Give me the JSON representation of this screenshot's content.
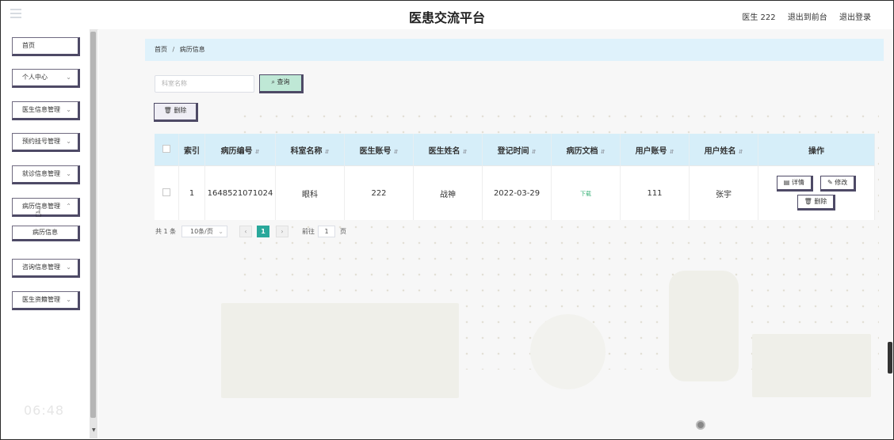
{
  "header": {
    "title": "医患交流平台",
    "user": "医生 222",
    "back_to_front": "退出到前台",
    "logout": "退出登录"
  },
  "sidebar": {
    "items": [
      {
        "label": "首页"
      },
      {
        "label": "个人中心"
      },
      {
        "label": "医生信息管理"
      },
      {
        "label": "预约挂号管理"
      },
      {
        "label": "就诊信息管理"
      },
      {
        "label": "病历信息管理"
      },
      {
        "label": "病历信息"
      },
      {
        "label": "咨询信息管理"
      },
      {
        "label": "医生资籍管理"
      }
    ],
    "timestamp": "06:48"
  },
  "breadcrumb": {
    "home": "首页",
    "sep": "/",
    "current": "病历信息"
  },
  "search": {
    "placeholder": "科室名称",
    "button": "查询"
  },
  "toolbar": {
    "delete": "删除"
  },
  "table": {
    "headers": [
      "索引",
      "病历编号",
      "科室名称",
      "医生账号",
      "医生姓名",
      "登记时间",
      "病历文档",
      "用户账号",
      "用户姓名",
      "操作"
    ],
    "rows": [
      {
        "index": "1",
        "record_no": "1648521071024",
        "department": "眼科",
        "doctor_account": "222",
        "doctor_name": "战神",
        "date": "2022-03-29",
        "document": "下载",
        "user_account": "111",
        "user_name": "张宇",
        "actions": {
          "detail": "详情",
          "edit": "修改",
          "delete": "删除"
        }
      }
    ]
  },
  "pagination": {
    "total": "共 1 条",
    "page_size": "10条/页",
    "current_page": "1",
    "goto_label": "前往",
    "goto_value": "1",
    "goto_unit": "页"
  },
  "icons": {
    "menu": "hamburger-icon",
    "search": "search-icon",
    "delete": "trash-icon",
    "detail": "document-icon",
    "edit": "pencil-icon"
  },
  "colors": {
    "breadcrumb_bg": "#dff2fb",
    "table_header_bg": "#d6eef9",
    "search_button_bg": "#bfe8d6",
    "active_page": "#2aa89b",
    "download_link": "#3cb37a"
  }
}
